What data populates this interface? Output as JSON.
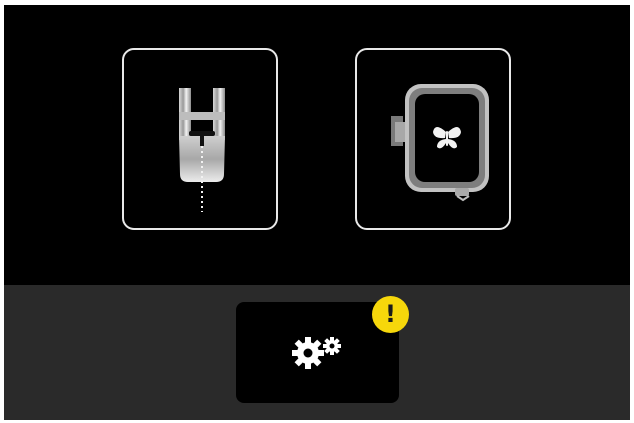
{
  "screen": {
    "modes": [
      {
        "id": "sewing",
        "icon": "presser-foot-icon"
      },
      {
        "id": "embroidery",
        "icon": "embroidery-hoop-butterfly-icon"
      }
    ],
    "settings": {
      "icon": "gears-icon",
      "alert": {
        "icon": "warning-icon",
        "symbol": "!"
      }
    }
  },
  "colors": {
    "screen_background": "#000000",
    "bottom_bar_background": "#2a2a2a",
    "tile_border": "#e9e9e9",
    "alert_yellow": "#f6d70b"
  }
}
